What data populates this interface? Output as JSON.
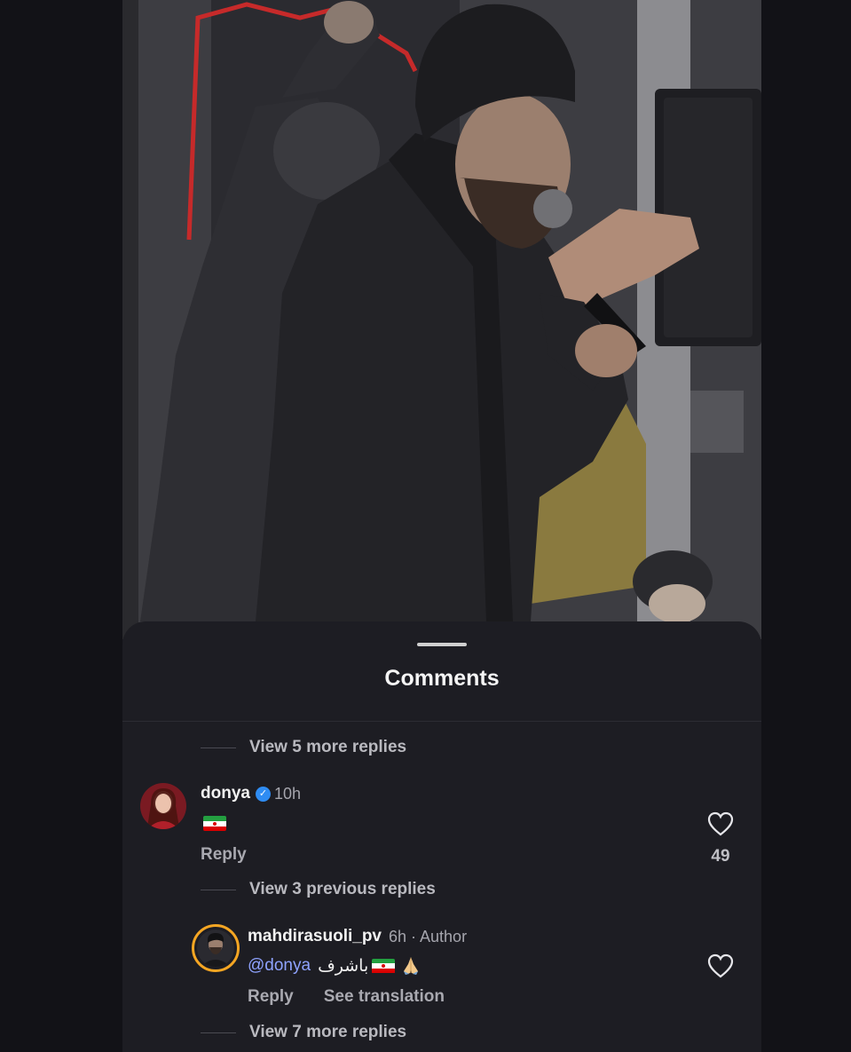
{
  "sheet": {
    "title": "Comments"
  },
  "threads": [
    {
      "view_more": "View 5 more replies"
    }
  ],
  "comments": [
    {
      "username": "donya",
      "verified": true,
      "time": "10h",
      "text_emoji": "iran-flag",
      "reply_label": "Reply",
      "likes": "49",
      "avatar_icon": "profile-photo"
    },
    {
      "username": "mahdirasuoli_pv",
      "time": "6h",
      "author_badge": "· Author",
      "mention": "@donya",
      "text": "باشرف",
      "emojis": [
        "iran-flag",
        "folded-hands"
      ],
      "reply_label": "Reply",
      "translate_label": "See translation",
      "avatar_icon": "profile-photo-with-story-ring"
    }
  ],
  "reply_links": {
    "previous": "View 3 previous replies",
    "more": "View 7 more replies"
  },
  "colors": {
    "background": "#121217",
    "sheet": "#1d1d23",
    "verified": "#2f8cf3",
    "mention": "#8fa3ff",
    "story_ring": "#f5a623"
  }
}
